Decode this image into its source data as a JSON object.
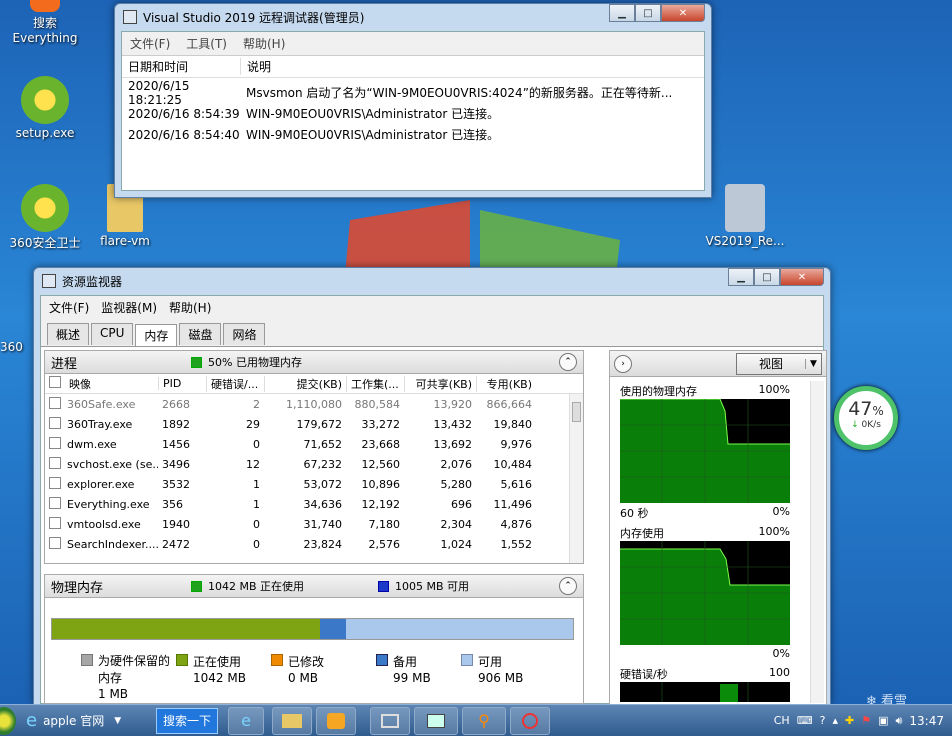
{
  "desktop": {
    "icons": [
      {
        "label": "搜索\nEverything",
        "name": "desktop-icon-everything-search"
      },
      {
        "label": "setup.exe",
        "name": "desktop-icon-setup"
      },
      {
        "label": "360安全卫士",
        "name": "desktop-icon-360"
      },
      {
        "label": "flare-vm",
        "name": "desktop-icon-flare-vm"
      },
      {
        "label": "VS2019_Re...",
        "name": "desktop-icon-vs2019"
      }
    ],
    "partial_labels": [
      "360"
    ]
  },
  "vs_window": {
    "title": "Visual Studio 2019 远程调试器(管理员)",
    "menu": [
      "文件(F)",
      "工具(T)",
      "帮助(H)"
    ],
    "columns": [
      "日期和时间",
      "说明"
    ],
    "rows": [
      {
        "time": "2020/6/15 18:21:25",
        "desc": "Msvsmon 启动了名为“WIN-9M0EOU0VRIS:4024”的新服务器。正在等待新..."
      },
      {
        "time": "2020/6/16 8:54:39",
        "desc": "WIN-9M0EOU0VRIS\\Administrator 已连接。"
      },
      {
        "time": "2020/6/16 8:54:40",
        "desc": "WIN-9M0EOU0VRIS\\Administrator 已连接。"
      }
    ]
  },
  "resmon": {
    "title": "资源监视器",
    "menu": [
      "文件(F)",
      "监视器(M)",
      "帮助(H)"
    ],
    "tabs": [
      "概述",
      "CPU",
      "内存",
      "磁盘",
      "网络"
    ],
    "active_tab": "内存",
    "process_panel": {
      "title": "进程",
      "status": "50% 已用物理内存",
      "columns": [
        "映像",
        "PID",
        "硬错误/...",
        "提交(KB)",
        "工作集(...",
        "可共享(KB)",
        "专用(KB)"
      ],
      "rows": [
        [
          "360Safe.exe",
          "2668",
          "2",
          "1,110,080",
          "880,584",
          "13,920",
          "866,664"
        ],
        [
          "360Tray.exe",
          "1892",
          "29",
          "179,672",
          "33,272",
          "13,432",
          "19,840"
        ],
        [
          "dwm.exe",
          "1456",
          "0",
          "71,652",
          "23,668",
          "13,692",
          "9,976"
        ],
        [
          "svchost.exe (se...",
          "3496",
          "12",
          "67,232",
          "12,560",
          "2,076",
          "10,484"
        ],
        [
          "explorer.exe",
          "3532",
          "1",
          "53,072",
          "10,896",
          "5,280",
          "5,616"
        ],
        [
          "Everything.exe",
          "356",
          "1",
          "34,636",
          "12,192",
          "696",
          "11,496"
        ],
        [
          "vmtoolsd.exe",
          "1940",
          "0",
          "31,740",
          "7,180",
          "2,304",
          "4,876"
        ],
        [
          "SearchIndexer....",
          "2472",
          "0",
          "23,824",
          "2,576",
          "1,024",
          "1,552"
        ]
      ]
    },
    "physical_panel": {
      "title": "物理内存",
      "in_use": "1042 MB 正在使用",
      "available": "1005 MB 可用",
      "bar_fractions": {
        "in_use": 0.515,
        "standby": 0.049,
        "available": 0.436
      },
      "legend": [
        {
          "label": "为硬件保留的\n内存",
          "value": "1 MB",
          "color": "#a6a6a6"
        },
        {
          "label": "正在使用",
          "value": "1042 MB",
          "color": "#7ea414"
        },
        {
          "label": "已修改",
          "value": "0 MB",
          "color": "#f08a00"
        },
        {
          "label": "备用",
          "value": "99 MB",
          "color": "#3c78c8"
        },
        {
          "label": "可用",
          "value": "906 MB",
          "color": "#a9c8ec"
        }
      ]
    },
    "graph_panel": {
      "view_label": "视图",
      "graphs": [
        {
          "title": "使用的物理内存",
          "max": "100%",
          "xlabel": "60 秒",
          "min": "0%"
        },
        {
          "title": "内存使用",
          "max": "100%",
          "min": "0%"
        },
        {
          "title": "硬错误/秒",
          "max": "100"
        }
      ]
    }
  },
  "speed_widget": {
    "percent": "47",
    "unit": "%",
    "rate": "0K/s"
  },
  "taskbar": {
    "ie_label": "apple 官网",
    "search_label": "搜索一下",
    "tray_lang": "CH",
    "clock": "13:47"
  },
  "watermark": "看雪"
}
